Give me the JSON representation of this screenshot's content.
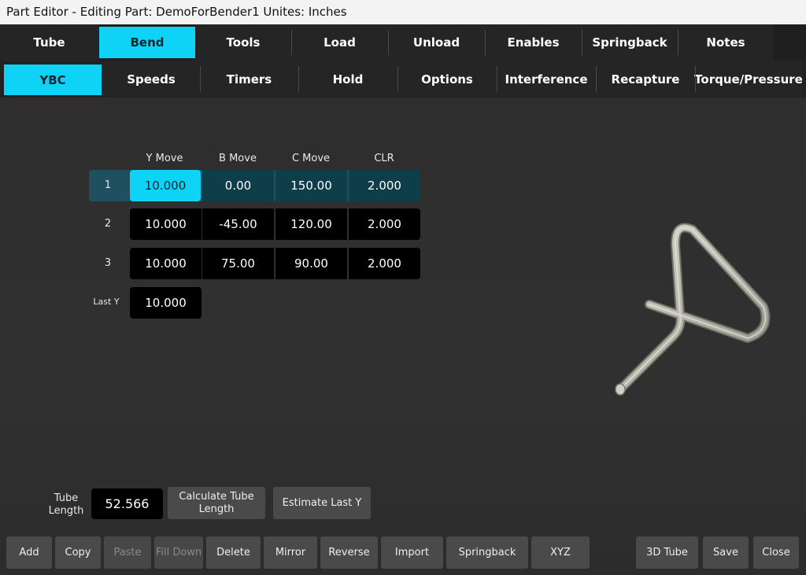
{
  "window": {
    "title": "Part Editor - Editing Part: DemoForBender1  Unites: Inches"
  },
  "main_tabs": [
    "Tube",
    "Bend",
    "Tools",
    "Load",
    "Unload",
    "Enables",
    "Springback",
    "Notes"
  ],
  "sub_tabs": [
    "YBC",
    "Speeds",
    "Timers",
    "Hold",
    "Options",
    "Interference",
    "Recapture",
    "Torque/Pressure"
  ],
  "grid": {
    "headers": [
      "Y Move",
      "B Move",
      "C Move",
      "CLR"
    ],
    "rows": [
      {
        "label": "1",
        "values": [
          "10.000",
          "0.00",
          "150.00",
          "2.000"
        ]
      },
      {
        "label": "2",
        "values": [
          "10.000",
          "-45.00",
          "120.00",
          "2.000"
        ]
      },
      {
        "label": "3",
        "values": [
          "10.000",
          "75.00",
          "90.00",
          "2.000"
        ]
      }
    ],
    "last_y": {
      "label": "Last Y",
      "value": "10.000"
    }
  },
  "tube_length": {
    "label_line1": "Tube",
    "label_line2": "Length",
    "value": "52.566"
  },
  "calc_button": {
    "line1": "Calculate Tube",
    "line2": "Length"
  },
  "estimate_button": "Estimate Last Y",
  "bottom_buttons": {
    "add": "Add",
    "copy": "Copy",
    "paste": "Paste",
    "fill_down": "Fill Down",
    "delete": "Delete",
    "mirror": "Mirror",
    "reverse": "Reverse",
    "import": "Import",
    "springback": "Springback",
    "xyz": "XYZ",
    "tube3d": "3D Tube",
    "save": "Save",
    "close": "Close"
  },
  "colors": {
    "accent": "#0fd2f7",
    "selected_row": "#0e3e4a",
    "tube": "#b9b9ad"
  },
  "icons": {
    "tube_preview": "bent-tube-3d-render"
  }
}
